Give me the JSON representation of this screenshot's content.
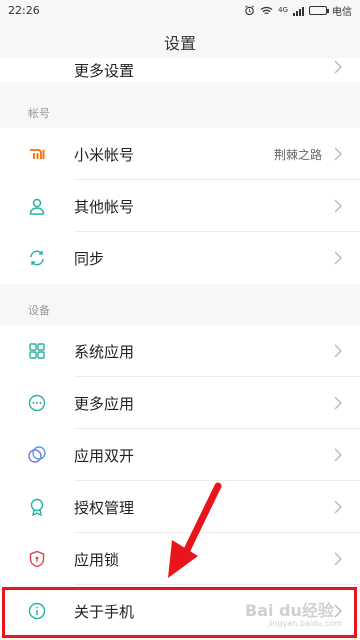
{
  "status_bar": {
    "time": "22:26",
    "network_4g": "4G",
    "carrier": "电信"
  },
  "header": {
    "title": "设置"
  },
  "top_row": {
    "label": "更多设置"
  },
  "account_section": {
    "title": "帐号",
    "items": [
      {
        "label": "小米帐号",
        "value": "荆棘之路",
        "icon": "mi-logo-icon"
      },
      {
        "label": "其他帐号",
        "icon": "person-icon"
      },
      {
        "label": "同步",
        "icon": "sync-icon"
      }
    ]
  },
  "device_section": {
    "title": "设备",
    "items": [
      {
        "label": "系统应用",
        "icon": "grid-icon"
      },
      {
        "label": "更多应用",
        "icon": "more-circle-icon"
      },
      {
        "label": "应用双开",
        "icon": "dual-apps-icon"
      },
      {
        "label": "授权管理",
        "icon": "badge-icon"
      },
      {
        "label": "应用锁",
        "icon": "shield-lock-icon"
      },
      {
        "label": "关于手机",
        "icon": "info-icon"
      }
    ]
  },
  "watermark": {
    "text": "Bai du经验",
    "sub": "jingyan.baidu.com"
  },
  "colors": {
    "accent_teal": "#26b3a4",
    "mi_orange": "#ff6900",
    "highlight_red": "#e8151b"
  }
}
